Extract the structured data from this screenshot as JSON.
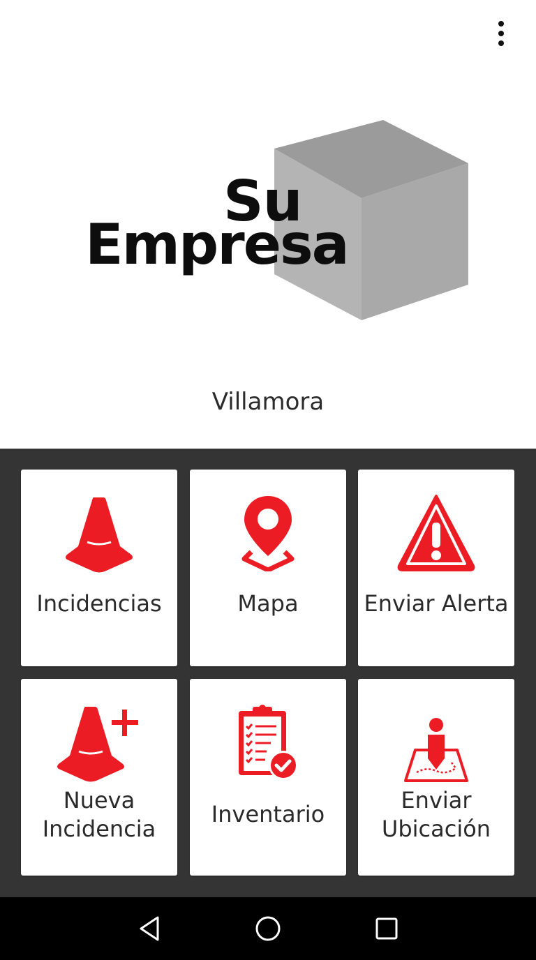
{
  "header": {
    "menu_icon": "more-vert-icon"
  },
  "logo": {
    "line1": "Su",
    "line2": "Empresa"
  },
  "location": "Villamora",
  "tiles": [
    {
      "label": "Incidencias",
      "icon": "traffic-cone-icon"
    },
    {
      "label": "Mapa",
      "icon": "map-pin-icon"
    },
    {
      "label": "Enviar Alerta",
      "icon": "warning-triangle-icon"
    },
    {
      "label_line1": "Nueva",
      "label_line2": "Incidencia",
      "icon": "traffic-cone-plus-icon"
    },
    {
      "label": "Inventario",
      "icon": "clipboard-check-icon"
    },
    {
      "label_line1": "Enviar",
      "label_line2": "Ubicación",
      "icon": "person-location-icon"
    }
  ],
  "navbar": {
    "back": "back-triangle-icon",
    "home": "home-circle-icon",
    "recents": "recents-square-icon"
  },
  "colors": {
    "accent": "#ec1c24",
    "grid_background": "#343434",
    "cube_light": "#b3b3b3",
    "cube_top": "#9e9e9e",
    "cube_right": "#a9a9a9"
  }
}
